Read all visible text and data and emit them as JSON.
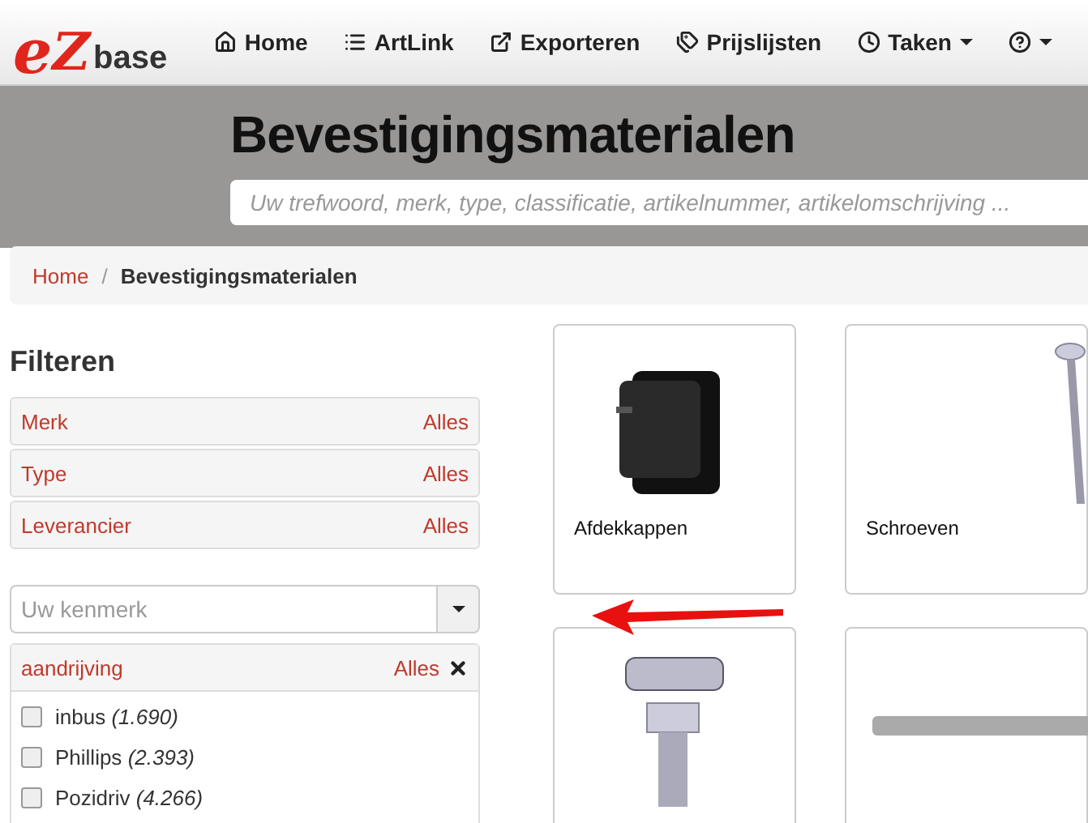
{
  "logo": {
    "letter_1": "e",
    "letter_2": "Z",
    "word": "base"
  },
  "nav": [
    {
      "kind": "home",
      "label": "Home",
      "dropdown": false
    },
    {
      "kind": "list",
      "label": "ArtLink",
      "dropdown": false
    },
    {
      "kind": "export",
      "label": "Exporteren",
      "dropdown": false
    },
    {
      "kind": "tags",
      "label": "Prijslijsten",
      "dropdown": false
    },
    {
      "kind": "clock",
      "label": "Taken",
      "dropdown": true
    },
    {
      "kind": "help",
      "dropdown": true
    }
  ],
  "header": {
    "title": "Bevestigingsmaterialen",
    "search": {
      "placeholder": "Uw trefwoord, merk, type, classificatie, artikelnummer, artikelomschrijving ..."
    }
  },
  "breadcrumb": {
    "separator": "/",
    "items": [
      {
        "label": "Home",
        "link": true
      },
      {
        "label": "Bevestigingsmaterialen",
        "link": false
      }
    ]
  },
  "filters": {
    "title": "Filteren",
    "groups": [
      {
        "label": "Merk",
        "value": "Alles"
      },
      {
        "label": "Type",
        "value": "Alles"
      },
      {
        "label": "Leverancier",
        "value": "Alles"
      }
    ],
    "feature_select": {
      "placeholder": "Uw kenmerk"
    },
    "facet": {
      "label": "aandrijving",
      "value": "Alles",
      "options": [
        {
          "label": "inbus",
          "count": "(1.690)",
          "checked": false
        },
        {
          "label": "Phillips",
          "count": "(2.393)",
          "checked": false
        },
        {
          "label": "Pozidriv",
          "count": "(4.266)",
          "checked": false
        }
      ]
    }
  },
  "products": [
    {
      "kind": "cap",
      "label": "Afdekkappen"
    },
    {
      "kind": "screw",
      "label": "Schroeven"
    },
    {
      "kind": "bolt"
    },
    {
      "kind": "anchor"
    }
  ]
}
